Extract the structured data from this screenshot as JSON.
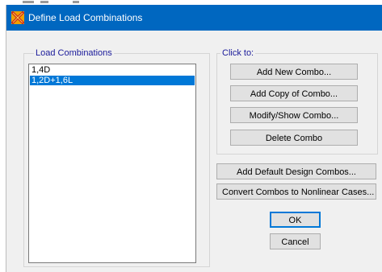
{
  "window": {
    "title": "Define Load Combinations"
  },
  "load_combinations": {
    "label": "Load Combinations",
    "items": [
      {
        "label": "1,4D",
        "selected": false
      },
      {
        "label": "1,2D+1,6L",
        "selected": true
      }
    ]
  },
  "click_to": {
    "label": "Click to:",
    "add_new": "Add New Combo...",
    "add_copy": "Add Copy of Combo...",
    "modify_show": "Modify/Show Combo...",
    "delete": "Delete Combo"
  },
  "actions": {
    "add_default": "Add Default Design Combos...",
    "convert": "Convert Combos to Nonlinear Cases..."
  },
  "dialog": {
    "ok": "OK",
    "cancel": "Cancel"
  },
  "colors": {
    "titlebar": "#0067c0",
    "selection": "#0078d7",
    "group_label": "#1a1a9a"
  },
  "icons": {
    "app": "sap-x-icon"
  }
}
